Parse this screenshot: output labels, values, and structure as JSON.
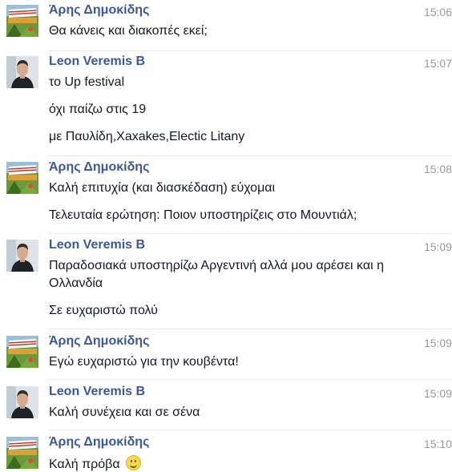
{
  "thread": {
    "groups": [
      {
        "sender": "Άρης Δημοκίδης",
        "time": "15:06",
        "avatar": "festival-flag-avatar",
        "lines": [
          "Θα κάνεις και διακοπές εκεί;"
        ]
      },
      {
        "sender": "Leon Veremis B",
        "time": "15:07",
        "avatar": "person-photo-avatar",
        "lines": [
          "το Up festival",
          "όχι παίζω στις 19",
          "με Παυλίδη,Xaxakes,Electic Litany"
        ]
      },
      {
        "sender": "Άρης Δημοκίδης",
        "time": "15:08",
        "avatar": "festival-flag-avatar",
        "lines": [
          "Καλή επιτυχία (και διασκέδαση) εύχομαι",
          "Τελευταία ερώτηση: Ποιον υποστηρίζεις στο Μουντιάλ;"
        ]
      },
      {
        "sender": "Leon Veremis B",
        "time": "15:09",
        "avatar": "person-photo-avatar",
        "lines": [
          "Παραδοσιακά υποστηρίζω Αργεντινή αλλά μου αρέσει και η",
          "Ολλανδία",
          "Σε ευχαριστώ πολύ"
        ]
      },
      {
        "sender": "Άρης Δημοκίδης",
        "time": "15:09",
        "avatar": "festival-flag-avatar",
        "lines": [
          "Εγώ ευχαριστώ για την κουβέντα!"
        ]
      },
      {
        "sender": "Leon Veremis B",
        "time": "15:09",
        "avatar": "person-photo-avatar",
        "lines": [
          "Καλή συνέχεια και σε σένα"
        ]
      },
      {
        "sender": "Άρης Δημοκίδης",
        "time": "15:10",
        "avatar": "festival-flag-avatar",
        "lines": [
          "Καλή πρόβα"
        ],
        "emoticon": "smiley-icon"
      }
    ]
  }
}
